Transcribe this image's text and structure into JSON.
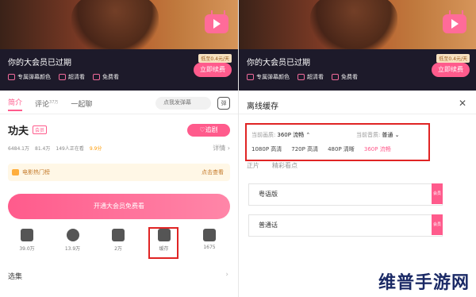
{
  "left": {
    "vip": {
      "title": "你的大会员已过期",
      "price_tag": "低至0.4元/天",
      "renew_button": "立即续费",
      "features": [
        {
          "icon": "danmu-color-icon",
          "label": "专属弹幕颜色"
        },
        {
          "icon": "hd-icon",
          "label": "超清看"
        },
        {
          "icon": "free-icon",
          "label": "免费看"
        }
      ]
    },
    "tabs": [
      {
        "label": "简介",
        "active": true
      },
      {
        "label": "评论",
        "count": "37万",
        "active": false
      },
      {
        "label": "一起聊",
        "active": false
      }
    ],
    "danmu_placeholder": "点我发弹幕",
    "danmu_toggle": "弹",
    "title": "功夫",
    "title_badge": "会员",
    "follow_button": "♡追剧",
    "stats": [
      "6484.1万",
      "81.4万",
      "149人正在看",
      "9.9分"
    ],
    "details_label": "详情 ›",
    "hotlist": {
      "label": "电影热门榜",
      "more": "点击查看"
    },
    "open_vip_button": "开通大会员免费看",
    "actions": [
      {
        "icon": "like-icon",
        "label": "39.0万"
      },
      {
        "icon": "coin-icon",
        "label": "13.9万"
      },
      {
        "icon": "star-icon",
        "label": "2万"
      },
      {
        "icon": "download-icon",
        "label": "缓存"
      },
      {
        "icon": "share-icon",
        "label": "1675"
      }
    ],
    "episode_label": "选集"
  },
  "right": {
    "vip": {
      "title": "你的大会员已过期",
      "price_tag": "低至0.4元/天",
      "renew_button": "立即续费",
      "features": [
        {
          "icon": "danmu-color-icon",
          "label": "专属弹幕颜色"
        },
        {
          "icon": "hd-icon",
          "label": "超清看"
        },
        {
          "icon": "free-icon",
          "label": "免费看"
        }
      ]
    },
    "header_title": "离线缓存",
    "close_label": "✕",
    "quality": {
      "current_label": "当前画质:",
      "current_value": "360P 流畅 ⌃",
      "audio_label": "当前音质:",
      "audio_value": "普通 ⌄",
      "options": [
        "1080P 高清",
        "720P 高清",
        "480P 清晰",
        "360P 流畅"
      ],
      "selected_index": 3
    },
    "content_tabs": [
      "正片",
      "精彩看点"
    ],
    "items": [
      {
        "label": "粤语版",
        "badge": "会员"
      },
      {
        "label": "普通话",
        "badge": "会员"
      }
    ]
  },
  "watermark": "维普手游网",
  "colors": {
    "accent": "#ff5b8c",
    "highlight_box": "#e02424",
    "vip_bar": "#1d1a2a"
  }
}
